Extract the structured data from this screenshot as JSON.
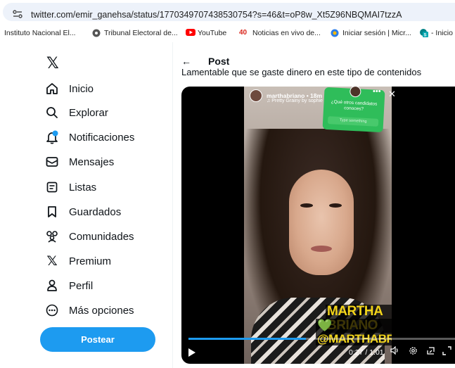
{
  "browser": {
    "url": "twitter.com/emir_ganehsa/status/1770349707438530754?s=46&t=oP8w_Xt5Z96NBQMAI7tzzA",
    "bookmarks": [
      {
        "label": "Instituto Nacional El...",
        "icon": "none"
      },
      {
        "label": "Tribunal Electoral de...",
        "icon": "globe-icon"
      },
      {
        "label": "YouTube",
        "icon": "youtube-icon"
      },
      {
        "label": "Noticias en vivo de...",
        "icon": "noticias-icon"
      },
      {
        "label": "Iniciar sesión | Micr...",
        "icon": "microsoft-icon"
      },
      {
        "label": "- Inicio",
        "icon": "sharepoint-icon"
      }
    ]
  },
  "sidebar": {
    "logo": "𝕏",
    "items": [
      {
        "label": "Inicio",
        "icon": "home-icon"
      },
      {
        "label": "Explorar",
        "icon": "search-icon"
      },
      {
        "label": "Notificaciones",
        "icon": "bell-icon"
      },
      {
        "label": "Mensajes",
        "icon": "envelope-icon"
      },
      {
        "label": "Listas",
        "icon": "list-icon"
      },
      {
        "label": "Guardados",
        "icon": "bookmark-icon"
      },
      {
        "label": "Comunidades",
        "icon": "communities-icon"
      },
      {
        "label": "Premium",
        "icon": "x-premium-icon"
      },
      {
        "label": "Perfil",
        "icon": "profile-icon"
      },
      {
        "label": "Más opciones",
        "icon": "more-icon"
      }
    ],
    "post_button": "Postear"
  },
  "main": {
    "back": "←",
    "title": "Post",
    "tweet_text": "Lamentable que se gaste dinero en este tipo de contenidos",
    "video": {
      "story_username": "marthabriano",
      "story_age": "18m",
      "story_music": "♫ Pretty Grainy by sophie",
      "sticker_question": "¿Qué otros candidatos conoces?",
      "sticker_answer": "Type something",
      "caption_line1": "MARTHA BRIANO",
      "caption_line2": "@MARTHABRIANO",
      "caption_heart": "💚",
      "time": "0:27 / 1:01",
      "progress": 0.44,
      "accent_color": "#1d9bf0"
    }
  }
}
